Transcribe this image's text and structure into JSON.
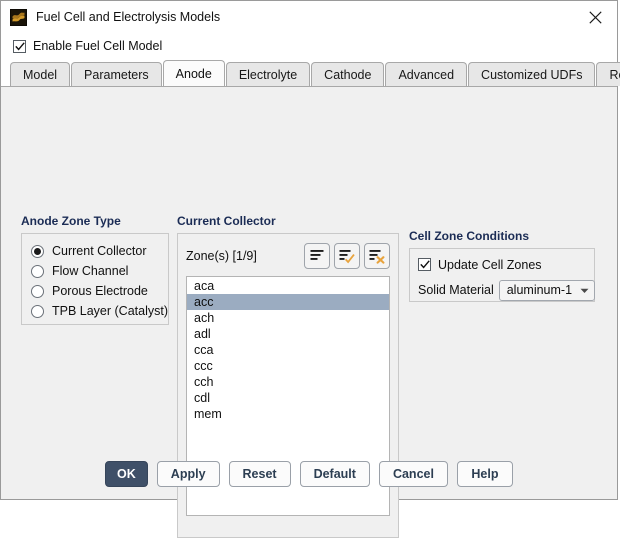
{
  "window": {
    "title": "Fuel Cell and Electrolysis Models",
    "app_icon": "fluent-app-icon",
    "close_icon": "close-icon"
  },
  "enable": {
    "label": "Enable Fuel Cell Model",
    "checked": true
  },
  "tabs": [
    {
      "label": "Model",
      "active": false
    },
    {
      "label": "Parameters",
      "active": false
    },
    {
      "label": "Anode",
      "active": true
    },
    {
      "label": "Electrolyte",
      "active": false
    },
    {
      "label": "Cathode",
      "active": false
    },
    {
      "label": "Advanced",
      "active": false
    },
    {
      "label": "Customized UDFs",
      "active": false
    },
    {
      "label": "Reports",
      "active": false
    }
  ],
  "anode_zone_type": {
    "title": "Anode Zone Type",
    "options": [
      {
        "label": "Current Collector",
        "selected": true
      },
      {
        "label": "Flow Channel",
        "selected": false
      },
      {
        "label": "Porous Electrode",
        "selected": false
      },
      {
        "label": "TPB Layer (Catalyst)",
        "selected": false
      }
    ]
  },
  "current_collector": {
    "title": "Current Collector",
    "zones_label": "Zone(s)  [1/9]",
    "toolbar": [
      {
        "name": "list-icon",
        "tooltip": ""
      },
      {
        "name": "list-select-all-icon",
        "tooltip": ""
      },
      {
        "name": "list-deselect-all-icon",
        "tooltip": ""
      }
    ],
    "zones": [
      {
        "name": "aca",
        "selected": false
      },
      {
        "name": "acc",
        "selected": true
      },
      {
        "name": "ach",
        "selected": false
      },
      {
        "name": "adl",
        "selected": false
      },
      {
        "name": "cca",
        "selected": false
      },
      {
        "name": "ccc",
        "selected": false
      },
      {
        "name": "cch",
        "selected": false
      },
      {
        "name": "cdl",
        "selected": false
      },
      {
        "name": "mem",
        "selected": false
      }
    ]
  },
  "cell_zone_conditions": {
    "title": "Cell Zone Conditions",
    "update_cell_zones": {
      "label": "Update Cell Zones",
      "checked": true
    },
    "solid_material": {
      "label": "Solid Material",
      "value": "aluminum-1",
      "options": [
        "aluminum-1"
      ]
    }
  },
  "footer_buttons": [
    {
      "label": "OK",
      "primary": true
    },
    {
      "label": "Apply",
      "primary": false
    },
    {
      "label": "Reset",
      "primary": false
    },
    {
      "label": "Default",
      "primary": false
    },
    {
      "label": "Cancel",
      "primary": false
    },
    {
      "label": "Help",
      "primary": false
    }
  ],
  "colors": {
    "panel_title": "#1b2c55",
    "selection": "#9bacc1",
    "primary_button": "#3f5068",
    "button_text": "#2c3e52",
    "accent_icon": "#e8a33d"
  }
}
